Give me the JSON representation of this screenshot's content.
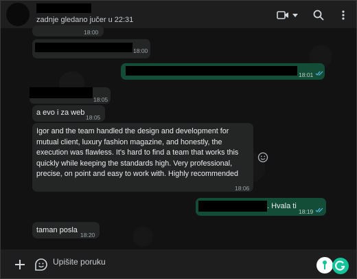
{
  "header": {
    "last_seen": "zadnje gledano jučer u 22:31"
  },
  "messages": [
    {
      "time": "18:00"
    },
    {
      "time": "18:00"
    },
    {
      "time": "18:01"
    },
    {
      "time": "18:05"
    },
    {
      "text": "a evo i za web",
      "time": "18:05"
    },
    {
      "text_lines": [
        "Igor and the team handled the design and development for",
        "mutual client, luxury fashion magazine, and honestly, the",
        "execution was flawless. It's hard to find a team that works this",
        "quickly while keeping the standards high. Very professional,",
        "precise, on point and easy to work with. Highly recommended"
      ],
      "time": "18:06"
    },
    {
      "text": ". Hvala ti",
      "time": "18:19"
    },
    {
      "text": "taman posla",
      "time": "18:20"
    }
  ],
  "composer": {
    "placeholder": "Upišite poruku"
  },
  "icons": {
    "video": "video-camera-icon",
    "search": "search-icon",
    "menu": "kebab-menu-icon",
    "plus": "plus-icon",
    "sticker": "sticker-icon",
    "grammarly": "grammarly-icon",
    "emoji": "emoji-smile-icon"
  },
  "colors": {
    "outgoing_bubble": "#144d37",
    "incoming_bubble": "#242626",
    "read_ticks": "#53bdeb",
    "grammarly": "#15c39a"
  }
}
